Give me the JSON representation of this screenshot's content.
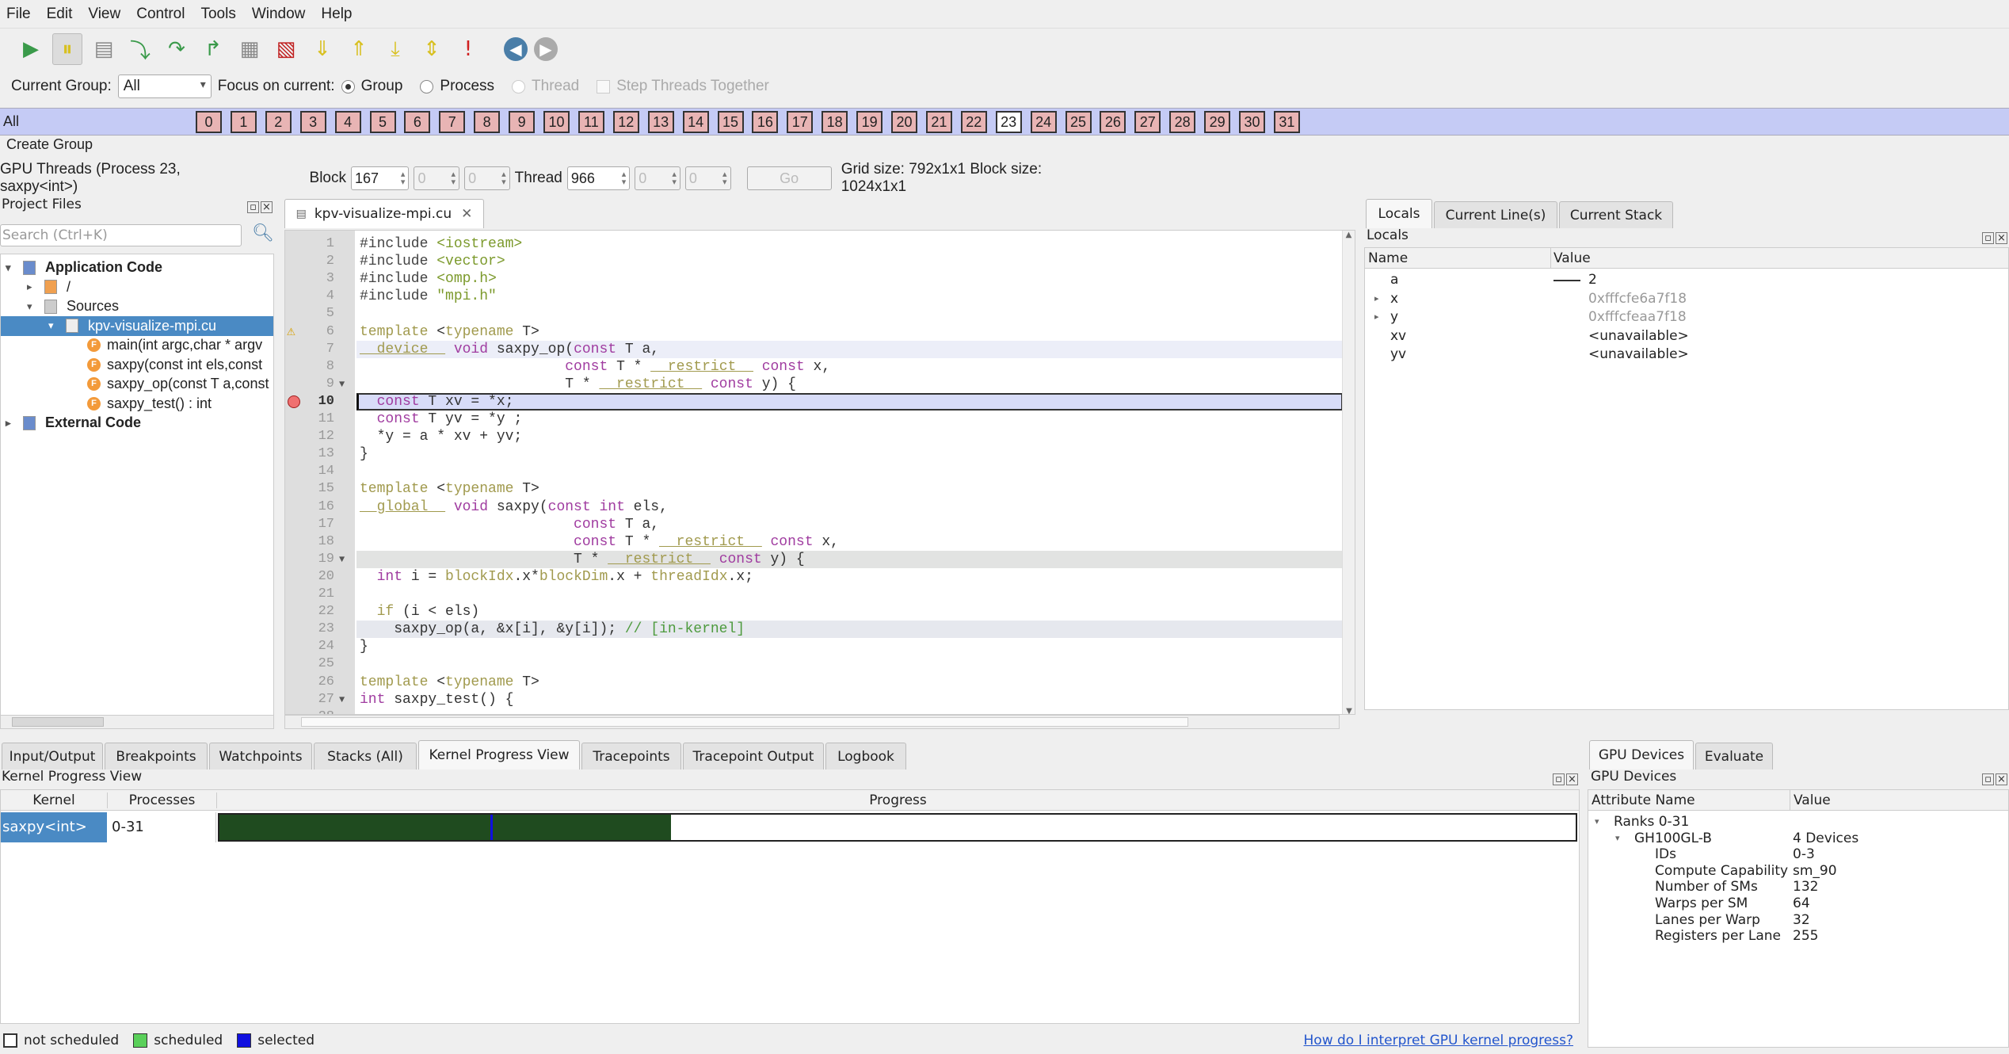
{
  "menu": [
    "File",
    "Edit",
    "View",
    "Control",
    "Tools",
    "Window",
    "Help"
  ],
  "toolbar": [
    {
      "name": "play-icon",
      "glyph": "▶",
      "color": "#3a9a4a"
    },
    {
      "name": "pause-icon",
      "glyph": "⏸",
      "color": "#d8c020",
      "active": true
    },
    {
      "name": "run-to-line-icon",
      "glyph": "▤",
      "color": "#888"
    },
    {
      "name": "step-into-icon",
      "glyph": "⤵",
      "color": "#3a9a4a"
    },
    {
      "name": "step-over-icon",
      "glyph": "↷",
      "color": "#3a9a4a"
    },
    {
      "name": "step-out-icon",
      "glyph": "↱",
      "color": "#3a9a4a"
    },
    {
      "name": "binary-icon",
      "glyph": "▦",
      "color": "#888"
    },
    {
      "name": "jump-to-line-icon",
      "glyph": "▧",
      "color": "#c02020"
    },
    {
      "name": "down-frame-icon",
      "glyph": "⇓",
      "color": "#d8c020"
    },
    {
      "name": "up-frame-icon",
      "glyph": "⇑",
      "color": "#d8c020"
    },
    {
      "name": "bottom-frame-icon",
      "glyph": "⤓",
      "color": "#d8c020"
    },
    {
      "name": "align-stack-icon",
      "glyph": "⇕",
      "color": "#d8c020"
    },
    {
      "name": "exclamation-icon",
      "glyph": "!",
      "color": "#d02020"
    },
    {
      "name": "back-icon",
      "glyph": "◀",
      "color": "#4a7ea8"
    },
    {
      "name": "forward-icon",
      "glyph": "▶",
      "color": "#aaa"
    }
  ],
  "groupbar": {
    "current_group_label": "Current Group:",
    "current_group_value": "All",
    "focus_label": "Focus on current:",
    "group": "Group",
    "process": "Process",
    "thread": "Thread",
    "step_together": "Step Threads Together"
  },
  "threads": {
    "all_label": "All",
    "current": 23,
    "items": [
      "0",
      "1",
      "2",
      "3",
      "4",
      "5",
      "6",
      "7",
      "8",
      "9",
      "10",
      "11",
      "12",
      "13",
      "14",
      "15",
      "16",
      "17",
      "18",
      "19",
      "20",
      "21",
      "22",
      "23",
      "24",
      "25",
      "26",
      "27",
      "28",
      "29",
      "30",
      "31"
    ]
  },
  "create_group": "Create Group",
  "gpu_threads": {
    "label": "GPU Threads (Process 23, saxpy<int>)",
    "block_label": "Block",
    "block": "167",
    "block_y": "0",
    "block_z": "0",
    "thread_label": "Thread",
    "thread": "966",
    "thread_y": "0",
    "thread_z": "0",
    "go": "Go",
    "grid_info": "Grid size: 792x1x1 Block size: 1024x1x1"
  },
  "project": {
    "title": "Project Files",
    "search_placeholder": "Search (Ctrl+K)",
    "tree": [
      {
        "label": "Application Code",
        "level": 0,
        "arrow": "▾",
        "icon": "app",
        "bold": true
      },
      {
        "label": "/",
        "level": 1,
        "arrow": "▸",
        "icon": "folder"
      },
      {
        "label": "Sources",
        "level": 1,
        "arrow": "▾",
        "icon": "sources"
      },
      {
        "label": "kpv-visualize-mpi.cu",
        "level": 2,
        "arrow": "▾",
        "icon": "file",
        "selected": true
      },
      {
        "label": "main(int argc,char * argv",
        "level": 3,
        "icon": "fn"
      },
      {
        "label": "saxpy(const int els,const",
        "level": 3,
        "icon": "fn"
      },
      {
        "label": "saxpy_op(const T a,const",
        "level": 3,
        "icon": "fn"
      },
      {
        "label": "saxpy_test() : int",
        "level": 3,
        "icon": "fn"
      },
      {
        "label": "External Code",
        "level": 0,
        "arrow": "▸",
        "icon": "app",
        "bold": true
      }
    ]
  },
  "editor": {
    "tab": "kpv-visualize-mpi.cu",
    "lines": [
      [
        [
          "#include ",
          "pp"
        ],
        [
          "<iostream>",
          "inc"
        ]
      ],
      [
        [
          "#include ",
          "pp"
        ],
        [
          "<vector>",
          "inc"
        ]
      ],
      [
        [
          "#include ",
          "pp"
        ],
        [
          "<omp.h>",
          "inc"
        ]
      ],
      [
        [
          "#include ",
          "pp"
        ],
        [
          "\"mpi.h\"",
          "inc"
        ]
      ],
      [],
      [
        [
          "template ",
          "tpl"
        ],
        [
          "<",
          "id"
        ],
        [
          "typename",
          "tpl"
        ],
        [
          " T>",
          "id"
        ]
      ],
      [
        [
          "__device__",
          "cu"
        ],
        [
          " void ",
          "kw"
        ],
        [
          "saxpy_op(",
          "id"
        ],
        [
          "const",
          "kw"
        ],
        [
          " T a,",
          "id"
        ]
      ],
      [
        [
          "                        ",
          "id"
        ],
        [
          "const",
          "kw"
        ],
        [
          " T * ",
          "id"
        ],
        [
          "__restrict__",
          "cu"
        ],
        [
          " const",
          "kw"
        ],
        [
          " x,",
          "id"
        ]
      ],
      [
        [
          "                        T * ",
          "id"
        ],
        [
          "__restrict__",
          "cu"
        ],
        [
          " const",
          "kw"
        ],
        [
          " y) {",
          "id"
        ]
      ],
      [
        [
          "  ",
          "id"
        ],
        [
          "const",
          "kw"
        ],
        [
          " T xv = *x;",
          "id"
        ]
      ],
      [
        [
          "  ",
          "id"
        ],
        [
          "const",
          "kw"
        ],
        [
          " T yv = *y ;",
          "id"
        ]
      ],
      [
        [
          "  *y = a * xv + yv;",
          "id"
        ]
      ],
      [
        [
          "}",
          "id"
        ]
      ],
      [],
      [
        [
          "template ",
          "tpl"
        ],
        [
          "<",
          "id"
        ],
        [
          "typename",
          "tpl"
        ],
        [
          " T>",
          "id"
        ]
      ],
      [
        [
          "__global__",
          "cu"
        ],
        [
          " void ",
          "kw"
        ],
        [
          "saxpy(",
          "id"
        ],
        [
          "const int",
          "kw"
        ],
        [
          " els,",
          "id"
        ]
      ],
      [
        [
          "                         ",
          "id"
        ],
        [
          "const",
          "kw"
        ],
        [
          " T a,",
          "id"
        ]
      ],
      [
        [
          "                         ",
          "id"
        ],
        [
          "const",
          "kw"
        ],
        [
          " T * ",
          "id"
        ],
        [
          "__restrict__",
          "cu"
        ],
        [
          " const",
          "kw"
        ],
        [
          " x,",
          "id"
        ]
      ],
      [
        [
          "                         T * ",
          "id"
        ],
        [
          "__restrict__",
          "cu"
        ],
        [
          " const",
          "kw"
        ],
        [
          " y) {",
          "id"
        ]
      ],
      [
        [
          "  ",
          "id"
        ],
        [
          "int",
          "kw"
        ],
        [
          " i = ",
          "id"
        ],
        [
          "blockIdx",
          "tpl"
        ],
        [
          ".x*",
          "id"
        ],
        [
          "blockDim",
          "tpl"
        ],
        [
          ".x + ",
          "id"
        ],
        [
          "threadIdx",
          "tpl"
        ],
        [
          ".x;",
          "id"
        ]
      ],
      [],
      [
        [
          "  ",
          "id"
        ],
        [
          "if",
          "tpl"
        ],
        [
          " (i < els)",
          "id"
        ]
      ],
      [
        [
          "    saxpy_op(a, &x[i], &y[i]); ",
          "id"
        ],
        [
          "// [in-kernel]",
          "cm"
        ]
      ],
      [
        [
          "}",
          "id"
        ]
      ],
      [],
      [
        [
          "template ",
          "tpl"
        ],
        [
          "<",
          "id"
        ],
        [
          "typename",
          "tpl"
        ],
        [
          " T>",
          "id"
        ]
      ],
      [
        [
          "int",
          "kw"
        ],
        [
          " saxpy_test() {",
          "id"
        ]
      ],
      []
    ],
    "current_line": 10,
    "warning_line": 6,
    "breakpoint_line": 10,
    "fold_lines": [
      9,
      19,
      27
    ],
    "shaded_lines": [
      7,
      19,
      23
    ]
  },
  "right": {
    "tabs": [
      "Locals",
      "Current Line(s)",
      "Current Stack"
    ],
    "panel_title": "Locals",
    "col_name": "Name",
    "col_value": "Value",
    "rows": [
      {
        "name": "a",
        "value": "2",
        "spark": true
      },
      {
        "name": "x",
        "value": "0xfffcfe6a7f18",
        "expand": true,
        "dim": true
      },
      {
        "name": "y",
        "value": "0xfffcfeaa7f18",
        "expand": true,
        "dim": true
      },
      {
        "name": "xv",
        "value": "<unavailable>"
      },
      {
        "name": "yv",
        "value": "<unavailable>"
      }
    ]
  },
  "bottom": {
    "tabs": [
      "Input/Output",
      "Breakpoints",
      "Watchpoints",
      "Stacks (All)",
      "Kernel Progress View",
      "Tracepoints",
      "Tracepoint Output",
      "Logbook"
    ],
    "selected_tab": 4,
    "panel_title": "Kernel Progress View",
    "col_kernel": "Kernel",
    "col_processes": "Processes",
    "col_progress": "Progress",
    "row": {
      "kernel": "saxpy<int>",
      "processes": "0-31",
      "progress": 0.333,
      "selected_marker": 0.2
    },
    "legend": {
      "not_scheduled": "not scheduled",
      "scheduled": "scheduled",
      "selected": "selected",
      "help_link": "How do I interpret GPU kernel progress?"
    }
  },
  "devices": {
    "tabs": [
      "GPU Devices",
      "Evaluate"
    ],
    "panel_title": "GPU Devices",
    "col_attr": "Attribute Name",
    "col_value": "Value",
    "rows": [
      {
        "name": "Ranks 0-31",
        "value": "",
        "level": 0,
        "arrow": "▾"
      },
      {
        "name": "GH100GL-B",
        "value": "4 Devices",
        "level": 1,
        "arrow": "▾"
      },
      {
        "name": "IDs",
        "value": "0-3",
        "level": 2
      },
      {
        "name": "Compute Capability",
        "value": "sm_90",
        "level": 2
      },
      {
        "name": "Number of SMs",
        "value": "132",
        "level": 2
      },
      {
        "name": "Warps per SM",
        "value": "64",
        "level": 2
      },
      {
        "name": "Lanes per Warp",
        "value": "32",
        "level": 2
      },
      {
        "name": "Registers per Lane",
        "value": "255",
        "level": 2
      }
    ]
  },
  "colors": {
    "threadbar": "#c5cbf5",
    "thread_btn": "#e8b4b4",
    "progress_fill": "#1f4b1f",
    "selected_marker": "#1010e0",
    "selection": "#4a8ac4"
  }
}
